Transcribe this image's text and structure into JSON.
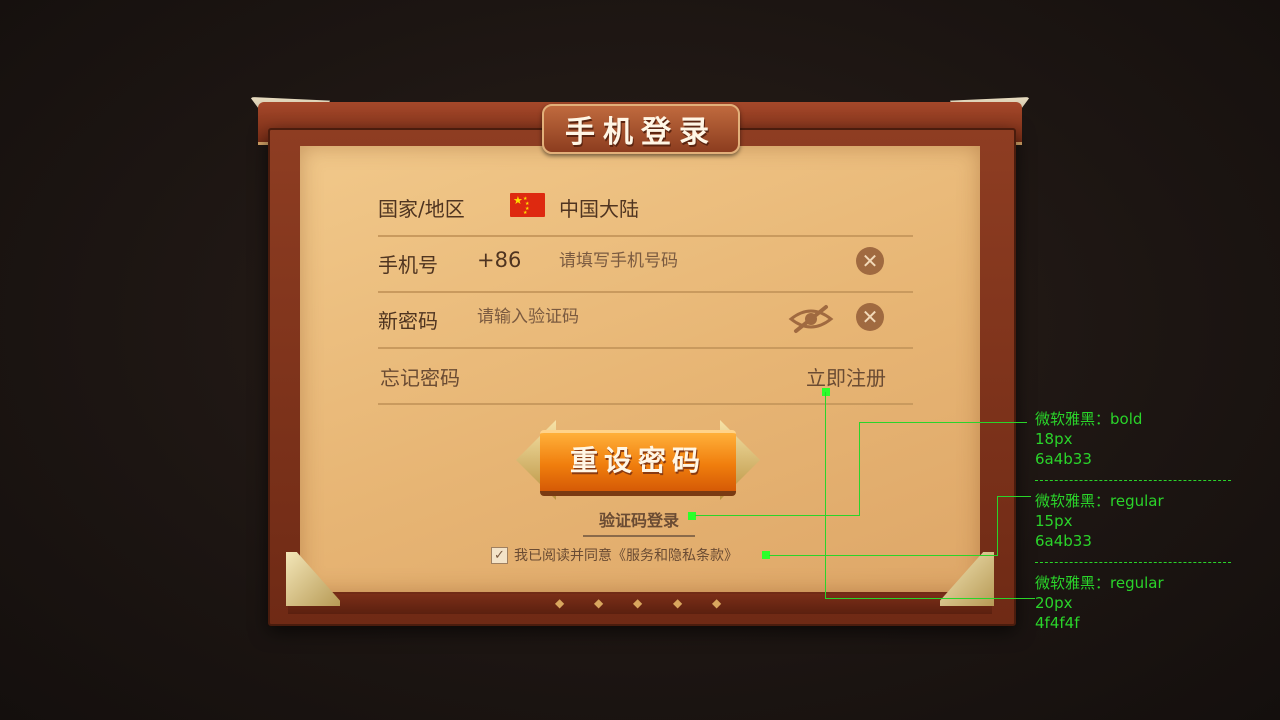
{
  "dialog": {
    "title": "手机登录",
    "country_label": "国家/地区",
    "country_value": "中国大陆",
    "phone_label": "手机号",
    "phone_code": "+86",
    "phone_placeholder": "请填写手机号码",
    "password_label": "新密码",
    "password_placeholder": "请输入验证码",
    "forgot_password": "忘记密码",
    "register": "立即注册",
    "reset_button": "重设密码",
    "sms_login": "验证码登录",
    "agreement": "我已阅读并同意《服务和隐私条款》",
    "agreement_checked": true
  },
  "annotations": [
    {
      "font": "微软雅黑：bold",
      "size": "18px",
      "color": "6a4b33"
    },
    {
      "font": "微软雅黑：regular",
      "size": "15px",
      "color": "6a4b33"
    },
    {
      "font": "微软雅黑：regular",
      "size": "20px",
      "color": "4f4f4f"
    }
  ],
  "colors": {
    "label_text": "#4f3420",
    "secondary_text": "#6a4b33",
    "parchment": "#e7b574",
    "frame": "#7a2e17",
    "annotation": "#2ad42a"
  }
}
